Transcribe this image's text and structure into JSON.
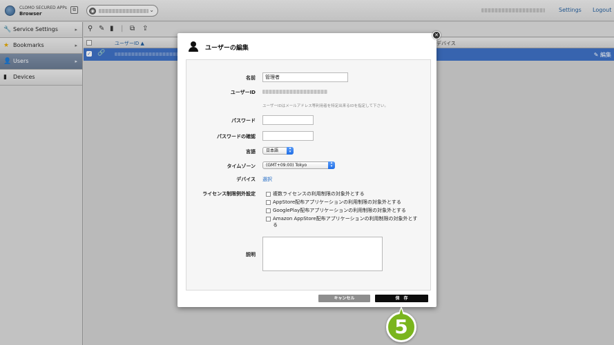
{
  "app": {
    "name_line1": "CLOMO SECURED APPs",
    "name_line2": "Browser",
    "app_icon_glyph": "⧉",
    "switch_icon_glyph": "◉",
    "caret_glyph": "⌄"
  },
  "header": {
    "settings_label": "Settings",
    "logout_label": "Logout"
  },
  "sidebar": {
    "items": [
      {
        "label": "Service Settings",
        "icon": "wrench-icon",
        "glyph": "🔧",
        "active": false
      },
      {
        "label": "Bookmarks",
        "icon": "star-icon",
        "glyph": "★",
        "active": false
      },
      {
        "label": "Users",
        "icon": "user-icon",
        "glyph": "👤",
        "active": true
      },
      {
        "label": "Devices",
        "icon": "device-icon",
        "glyph": "▮",
        "active": false
      }
    ],
    "arrow_glyph": "▸"
  },
  "toolbar": {
    "icons": [
      "add-user-icon",
      "edit-icon",
      "delete-icon",
      "copy-icon",
      "import-user-icon"
    ]
  },
  "table": {
    "col_userid": "ユーザーID ▲",
    "col_device": "デバイス",
    "row_check_glyph": "✓",
    "row_link_glyph": "🔗",
    "row_edit_label": "✎ 編集"
  },
  "modal": {
    "title": "ユーザーの編集",
    "close_glyph": "✕",
    "fields": {
      "name_label": "名前",
      "name_value": "管理者",
      "userid_label": "ユーザーID",
      "userid_hint": "ユーザーIDはメールアドレス等利用者を特定出来るIDを指定して下さい。",
      "password_label": "パスワード",
      "password_confirm_label": "パスワードの確認",
      "language_label": "言語",
      "language_value": "日本語",
      "timezone_label": "タイムゾーン",
      "timezone_value": "(GMT+09:00) Tokyo",
      "device_label": "デバイス",
      "device_link": "選択",
      "license_label": "ライセンス制限例外設定",
      "license_options": [
        "複数ライセンスの利用制限の対象外とする",
        "AppStore配布アプリケーションの利用制限の対象外とする",
        "GooglePlay配布アプリケーションの利用制限の対象外とする",
        "Amazon AppStore配布アプリケーションの利用制限の対象外とする"
      ],
      "description_label": "説明"
    },
    "cancel_label": "キャンセル",
    "save_label": "保　存"
  },
  "step_badge": "5",
  "colors": {
    "accent": "#3b6ec3",
    "badge": "#7ab51d",
    "link": "#1d68c4"
  }
}
